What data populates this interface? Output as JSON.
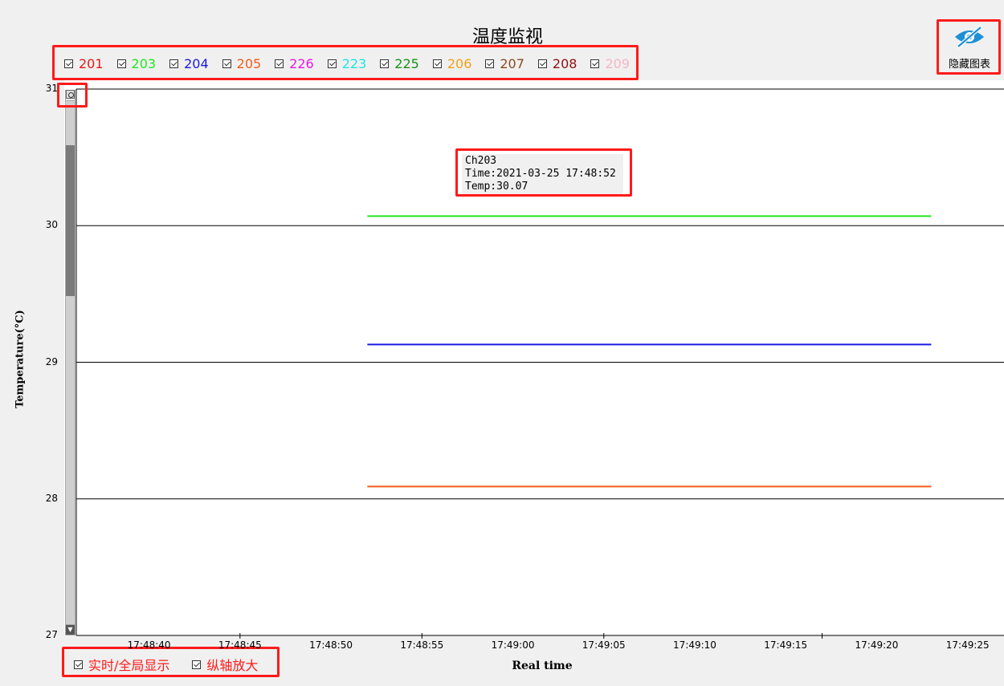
{
  "title": "温度监视",
  "hide_chart_label": "隐藏图表",
  "legend": [
    {
      "label": "201",
      "color": "#e61919",
      "checked": true
    },
    {
      "label": "203",
      "color": "#22e622",
      "checked": true
    },
    {
      "label": "204",
      "color": "#1a1ae6",
      "checked": true
    },
    {
      "label": "205",
      "color": "#f25c19",
      "checked": true
    },
    {
      "label": "226",
      "color": "#e619e6",
      "checked": true
    },
    {
      "label": "223",
      "color": "#19e6e6",
      "checked": true
    },
    {
      "label": "225",
      "color": "#179417",
      "checked": true
    },
    {
      "label": "206",
      "color": "#f2a019",
      "checked": true
    },
    {
      "label": "207",
      "color": "#8c4a1f",
      "checked": true
    },
    {
      "label": "208",
      "color": "#8c0f0f",
      "checked": true
    },
    {
      "label": "209",
      "color": "#f7b4c4",
      "checked": true
    }
  ],
  "tooltip": {
    "line1": "Ch203",
    "line2": "Time:2021-03-25 17:48:52",
    "line3": "Temp:30.07"
  },
  "bottom_options": {
    "realtime_label": "实时/全局显示",
    "zoom_label": "纵轴放大"
  },
  "chart_data": {
    "type": "line",
    "ylabel": "Temperature(°C)",
    "xlabel": "Real time",
    "ylim": [
      27,
      31
    ],
    "yticks": [
      "31",
      "30",
      "29",
      "28",
      "27"
    ],
    "xticks": [
      "17:48:40",
      "17:48:45",
      "17:48:50",
      "17:48:55",
      "17:49:00",
      "17:49:05",
      "17:49:10",
      "17:49:15",
      "17:49:20",
      "17:49:25"
    ],
    "grid": true,
    "series": [
      {
        "name": "203",
        "color": "#22e622",
        "x": [
          "17:48:52",
          "17:49:23"
        ],
        "values": [
          30.07,
          30.07
        ]
      },
      {
        "name": "204",
        "color": "#1a1ae6",
        "x": [
          "17:48:52",
          "17:49:23"
        ],
        "values": [
          29.13,
          29.13
        ]
      },
      {
        "name": "205",
        "color": "#f25c19",
        "x": [
          "17:48:52",
          "17:49:23"
        ],
        "values": [
          28.09,
          28.09
        ]
      }
    ]
  }
}
